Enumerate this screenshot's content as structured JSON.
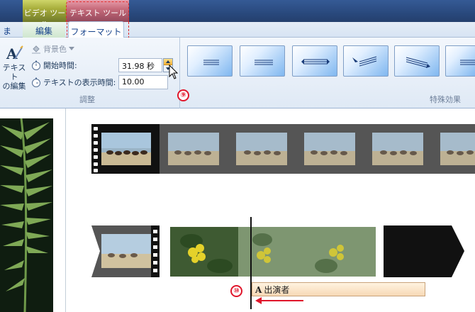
{
  "ribbon_header": {
    "context_video_tools": "ビデオ ツール",
    "context_text_tools": "テキスト ツール"
  },
  "tabs": {
    "partial": "ま",
    "edit": "編集",
    "format": "フォーマット"
  },
  "adjust_group": {
    "text_edit_line1": "テキスト",
    "text_edit_line2": "の編集",
    "background_label": "背景色",
    "start_time_label": "開始時間:",
    "start_time_value": "31.98 秒",
    "duration_label": "テキストの表示時間:",
    "duration_value": "10.00",
    "group_label": "調整"
  },
  "effects_group": {
    "group_label": "特殊効果",
    "effects": [
      "none",
      "horizontal-lines",
      "expand-arrows",
      "fly-in-lines",
      "slide-right-lines",
      "partial"
    ]
  },
  "callouts": {
    "step9": "⑨",
    "step10": "⑩"
  },
  "timeline": {
    "caption_label": "出演者",
    "caption_icon": "A"
  },
  "colors": {
    "callout_red": "#e0162b",
    "video_tools": "#a7ad3b",
    "text_tools": "#c76b7b"
  }
}
